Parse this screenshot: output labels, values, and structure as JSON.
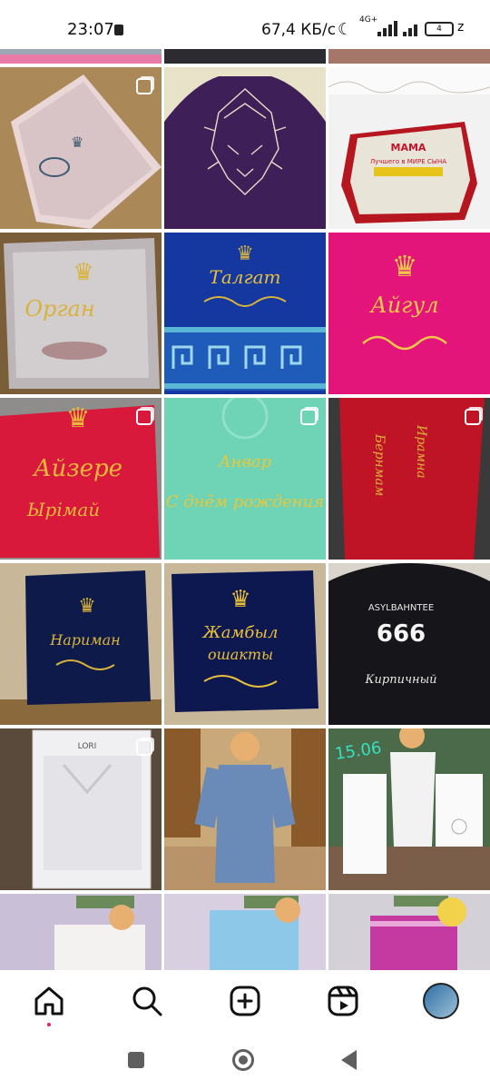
{
  "status_bar": {
    "time": "23:07",
    "net_speed": "67,4 КБ/с",
    "network_type": "4G+",
    "battery_label": "4",
    "tail": "z"
  },
  "grid": {
    "tiles": [
      {
        "title_1": "",
        "title_2": ""
      },
      {
        "title_1": "",
        "title_2": ""
      },
      {
        "title_1": "",
        "title_2": ""
      },
      {
        "title_1": "",
        "title_2": ""
      },
      {
        "title_1": "",
        "title_2": ""
      },
      {
        "title_1": "",
        "title_2": ""
      },
      {
        "title_1": "МАМА",
        "title_2": "Лучшего в МИРЕ СЫНА"
      },
      {
        "title_1": "Орган",
        "title_2": ""
      },
      {
        "title_1": "Талгат",
        "title_2": ""
      },
      {
        "title_1": "Айгул",
        "title_2": ""
      },
      {
        "title_1": "Айзере",
        "title_2": "Ырiмай"
      },
      {
        "title_1": "Анвар",
        "title_2": "С днём рождения"
      },
      {
        "title_1": "Бернмам",
        "title_2": "Ирамна"
      },
      {
        "title_1": "Нариман",
        "title_2": ""
      },
      {
        "title_1": "Жамбыл",
        "title_2": "ошакты"
      },
      {
        "title_1": "ASYLBAHNTEE",
        "title_2": "666"
      },
      {
        "title_1": "Кирпичный",
        "title_2": ""
      },
      {
        "title_1": "LORI",
        "title_2": ""
      },
      {
        "title_1": "15.06",
        "title_2": ""
      }
    ]
  },
  "bottom_nav": {
    "items": [
      {
        "icon": "home-icon"
      },
      {
        "icon": "search-icon"
      },
      {
        "icon": "add-post-icon"
      },
      {
        "icon": "reels-icon"
      },
      {
        "icon": "profile-avatar"
      }
    ]
  },
  "colors": {
    "accent": "#e0245e",
    "navy": "#0d1a4a",
    "gold": "#d9b23a",
    "pink": "#e3157a",
    "red": "#c2152b",
    "mint": "#6fd3b6",
    "purple": "#3f1f5a"
  }
}
